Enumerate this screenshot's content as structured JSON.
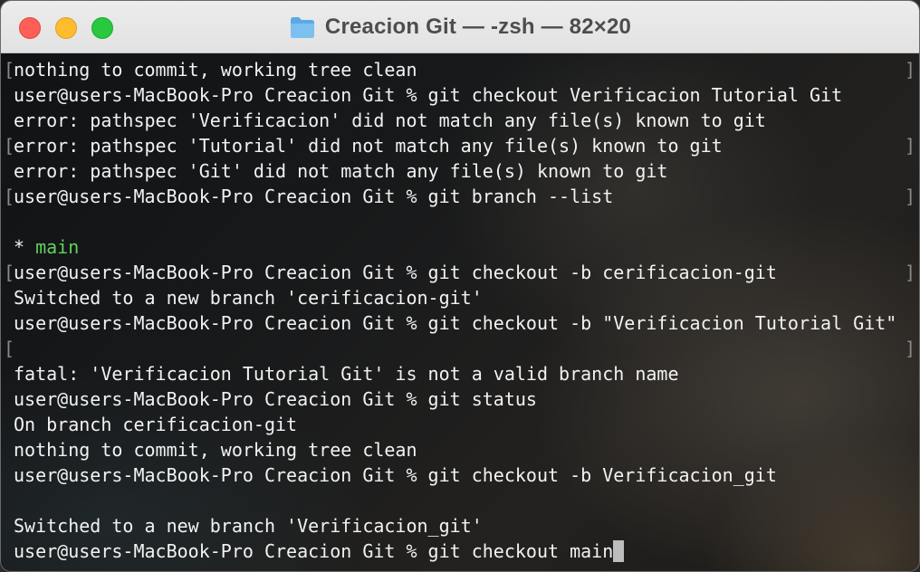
{
  "window": {
    "title": "Creacion Git — -zsh — 82×20"
  },
  "terminal": {
    "lines": [
      "nothing to commit, working tree clean",
      "user@users-MacBook-Pro Creacion Git % git checkout Verificacion Tutorial Git",
      "error: pathspec 'Verificacion' did not match any file(s) known to git",
      "error: pathspec 'Tutorial' did not match any file(s) known to git",
      "error: pathspec 'Git' did not match any file(s) known to git",
      "user@users-MacBook-Pro Creacion Git % git branch --list",
      "",
      "* ",
      "user@users-MacBook-Pro Creacion Git % git checkout -b cerificacion-git",
      "Switched to a new branch 'cerificacion-git'",
      "user@users-MacBook-Pro Creacion Git % git checkout -b \"Verificacion Tutorial Git\"",
      "",
      "fatal: 'Verificacion Tutorial Git' is not a valid branch name",
      "user@users-MacBook-Pro Creacion Git % git status",
      "On branch cerificacion-git",
      "nothing to commit, working tree clean",
      "user@users-MacBook-Pro Creacion Git % git checkout -b Verificacion_git",
      "",
      "Switched to a new branch 'Verificacion_git'",
      "user@users-MacBook-Pro Creacion Git % git checkout main"
    ],
    "current_branch_marker": "main",
    "colors": {
      "text": "#f2f2f2",
      "branch_highlight": "#5fd35f",
      "cursor": "#bdbdbd"
    }
  },
  "icons": {
    "folder": "folder-icon",
    "close": "close-button",
    "minimize": "minimize-button",
    "maximize": "maximize-button"
  }
}
